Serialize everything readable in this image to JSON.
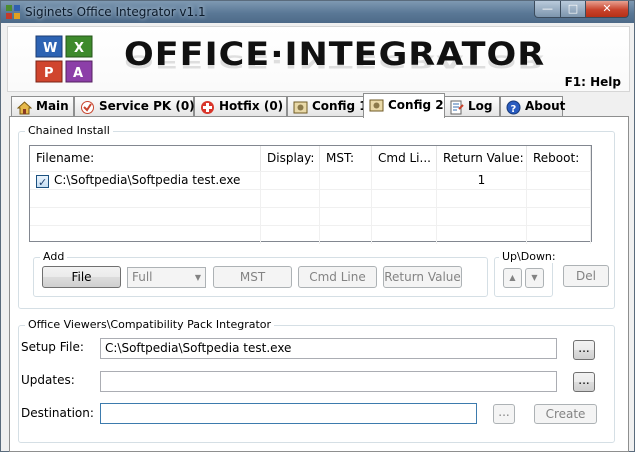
{
  "window": {
    "title": "Siginets Office Integrator v1.1",
    "controls": {
      "minimize": "—",
      "maximize": "□",
      "close": "✕"
    }
  },
  "banner": {
    "brand": "OFFICE·INTEGRATOR",
    "help": "F1: Help"
  },
  "tabs": [
    {
      "label": "Main",
      "icon": "house-icon",
      "active": false
    },
    {
      "label": "Service PK (0)",
      "icon": "service-pack-icon",
      "active": false
    },
    {
      "label": "Hotfix (0)",
      "icon": "hotfix-icon",
      "active": false
    },
    {
      "label": "Config 1",
      "icon": "config-icon",
      "active": false
    },
    {
      "label": "Config 2",
      "icon": "config-icon",
      "active": true
    },
    {
      "label": "Log",
      "icon": "log-icon",
      "active": false
    },
    {
      "label": "About",
      "icon": "help-icon",
      "active": false
    }
  ],
  "chained_install": {
    "group_label": "Chained Install",
    "columns": [
      "Filename:",
      "Display:",
      "MST:",
      "Cmd Li...",
      "Return Value:",
      "Reboot:"
    ],
    "rows": [
      {
        "checked": true,
        "filename": "C:\\Softpedia\\Softpedia test.exe",
        "display": "",
        "mst": "",
        "cmd": "",
        "return_value": "1",
        "reboot": ""
      }
    ],
    "add_group_label": "Add",
    "buttons": {
      "file": "File",
      "mode_select": "Full",
      "mst": "MST",
      "cmd_line": "Cmd Line",
      "return_value": "Return Value",
      "del": "Del"
    },
    "updown_label": "Up\\Down:"
  },
  "viewers": {
    "group_label": "Office Viewers\\Compatibility Pack Integrator",
    "setup_file_label": "Setup File:",
    "setup_file_value": "C:\\Softpedia\\Softpedia test.exe",
    "updates_label": "Updates:",
    "updates_value": "",
    "destination_label": "Destination:",
    "destination_value": "",
    "browse_label": "...",
    "create_label": "Create"
  },
  "colors": {
    "accent": "#3d7bad",
    "titlebar": "#5a7896",
    "close": "#c8432c"
  }
}
